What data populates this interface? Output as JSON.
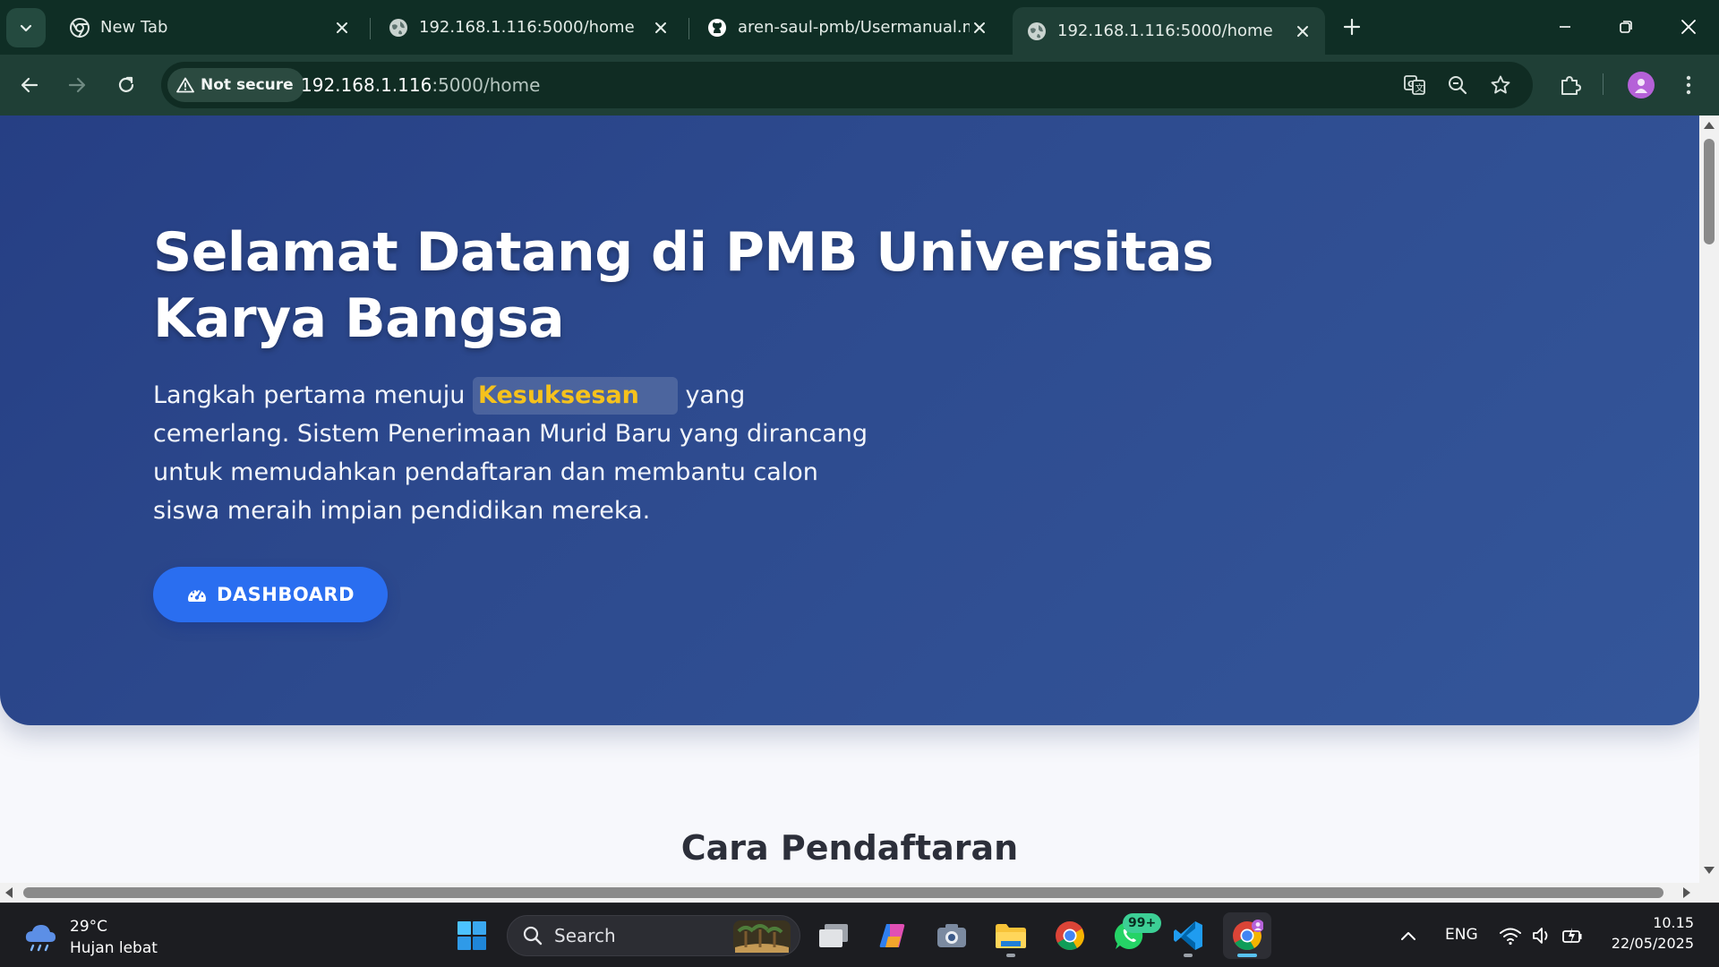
{
  "browser": {
    "tabs": [
      {
        "title": "New Tab",
        "icon": "chrome-icon",
        "active": false
      },
      {
        "title": "192.168.1.116:5000/home",
        "icon": "globe-icon",
        "active": false
      },
      {
        "title": "aren-saul-pmb/Usermanual.md",
        "icon": "github-icon",
        "active": false
      },
      {
        "title": "192.168.1.116:5000/home",
        "icon": "globe-icon",
        "active": true
      }
    ],
    "security_label": "Not secure",
    "url_host": "192.168.1.116",
    "url_path": ":5000/home",
    "colors": {
      "frame": "#0f2e25",
      "toolbar": "#1f3f36",
      "omnibox": "#102c23"
    }
  },
  "page": {
    "hero": {
      "title": "Selamat Datang di PMB Universitas Karya Bangsa",
      "desc_before": "Langkah pertama menuju ",
      "desc_highlight": "Kesuksesan",
      "desc_after": " yang cemerlang. Sistem Penerimaan Murid Baru yang dirancang untuk memudahkan pendaftaran dan membantu calon siswa meraih impian pendidikan mereka.",
      "button_label": "DASHBOARD",
      "colors": {
        "gradient_start": "#263f84",
        "gradient_end": "#34569a",
        "highlight_text": "#f6c21c",
        "button": "#2a6ef0"
      }
    },
    "section_title": "Cara Pendaftaran"
  },
  "taskbar": {
    "weather": {
      "temp": "29°C",
      "condition": "Hujan lebat"
    },
    "search_label": "Search",
    "apps": [
      "windows-start",
      "search",
      "task-view",
      "copilot",
      "camera",
      "file-explorer",
      "chrome",
      "whatsapp",
      "vscode",
      "chrome-profile"
    ],
    "whatsapp_badge": "99+",
    "language": "ENG",
    "time": "10.15",
    "date": "22/05/2025"
  }
}
